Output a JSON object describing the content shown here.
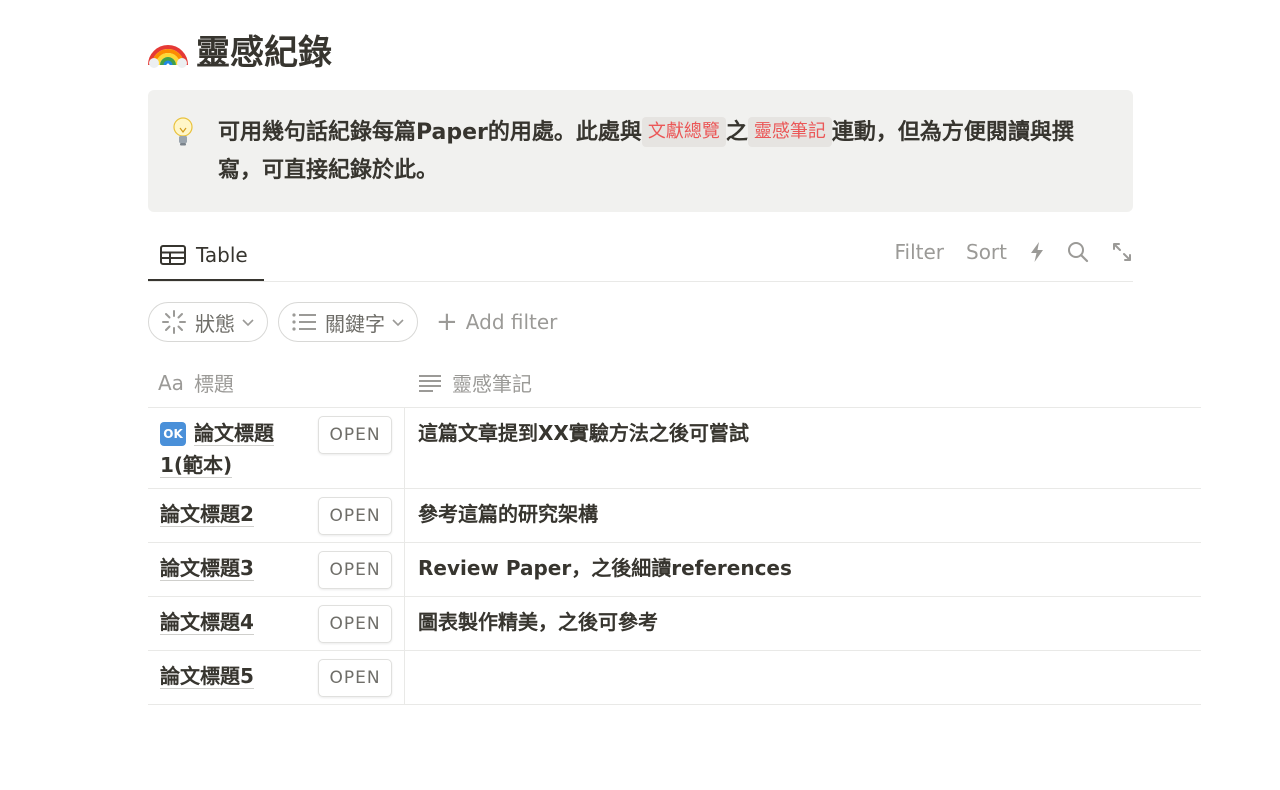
{
  "page": {
    "title": "靈感紀錄",
    "title_icon": "rainbow-icon"
  },
  "callout": {
    "icon": "lightbulb-icon",
    "text_part1": "可用幾句話紀錄每篇Paper的用處。此處與",
    "tag1": "文獻總覽",
    "text_part2": "之",
    "tag2": "靈感筆記",
    "text_part3": "連動，但為方便閱讀與撰寫，可直接紀錄於此。",
    "tag_color": "#eb5757"
  },
  "view": {
    "tab_label": "Table",
    "tab_icon": "table-icon",
    "actions": {
      "filter": "Filter",
      "sort": "Sort",
      "automation_icon": "lightning-icon",
      "search_icon": "search-icon",
      "expand_icon": "expand-icon"
    }
  },
  "filters": [
    {
      "label": "狀態",
      "icon": "status-spinner-icon"
    },
    {
      "label": "關鍵字",
      "icon": "list-icon"
    }
  ],
  "add_filter": "Add filter",
  "table": {
    "columns": [
      {
        "label": "標題",
        "icon_text": "Aa"
      },
      {
        "label": "靈感筆記",
        "icon": "text-lines-icon"
      }
    ],
    "open_label": "OPEN",
    "rows": [
      {
        "title": "論文標題1(範本)",
        "has_ok_icon": true,
        "note": "這篇文章提到XX實驗方法之後可嘗試"
      },
      {
        "title": "論文標題2",
        "note": "參考這篇的研究架構"
      },
      {
        "title": "論文標題3",
        "note": "Review Paper，之後細讀references"
      },
      {
        "title": "論文標題4",
        "note": "圖表製作精美，之後可參考"
      },
      {
        "title": "論文標題5",
        "note": ""
      }
    ]
  },
  "colors": {
    "text": "#37352f",
    "muted": "#9b9a97",
    "callout_bg": "#f1f1ef",
    "ok_badge": "#4a90d9"
  }
}
